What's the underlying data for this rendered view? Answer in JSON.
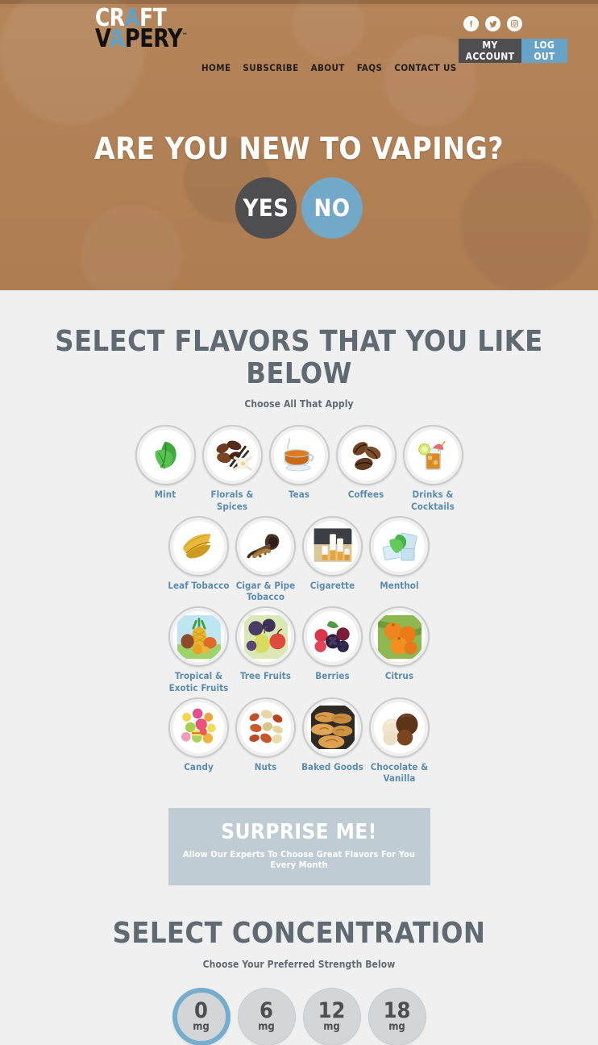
{
  "brand": {
    "logo_line1": "CRAFT",
    "logo_line2": "VAPERY",
    "trademark": "™",
    "accent_blue": "#64a0c4",
    "hero_bg": "#b28156",
    "page_bg": "#f0f0f0"
  },
  "header": {
    "social": [
      {
        "name": "facebook-icon",
        "label": "f"
      },
      {
        "name": "twitter-icon",
        "label": "t"
      },
      {
        "name": "instagram-icon",
        "label": "ig"
      }
    ],
    "my_account_label": "MY ACCOUNT",
    "log_out_label": "LOG OUT",
    "nav": [
      {
        "label": "HOME"
      },
      {
        "label": "SUBSCRIBE"
      },
      {
        "label": "ABOUT"
      },
      {
        "label": "FAQS"
      },
      {
        "label": "CONTACT US"
      }
    ]
  },
  "hero": {
    "question": "ARE YOU NEW TO VAPING?",
    "yes_label": "YES",
    "no_label": "NO"
  },
  "flavors_section": {
    "title": "SELECT FLAVORS THAT YOU LIKE BELOW",
    "subtitle": "Choose All That Apply",
    "rows": [
      [
        {
          "label": "Mint",
          "icon": "mint-leaves"
        },
        {
          "label": "Florals & Spices",
          "icon": "chocolate-vanilla-flower"
        },
        {
          "label": "Teas",
          "icon": "teacup"
        },
        {
          "label": "Coffees",
          "icon": "coffee-beans"
        },
        {
          "label": "Drinks & Cocktails",
          "icon": "cocktail-glass"
        }
      ],
      [
        {
          "label": "Leaf Tobacco",
          "icon": "tobacco-leaf"
        },
        {
          "label": "Cigar & Pipe Tobacco",
          "icon": "pipe"
        },
        {
          "label": "Cigarette",
          "icon": "cigarettes"
        },
        {
          "label": "Menthol",
          "icon": "mint-ice"
        }
      ],
      [
        {
          "label": "Tropical & Exotic Fruits",
          "icon": "pineapple-mango"
        },
        {
          "label": "Tree Fruits",
          "icon": "pear-apple-plum"
        },
        {
          "label": "Berries",
          "icon": "mixed-berries"
        },
        {
          "label": "Citrus",
          "icon": "oranges"
        }
      ],
      [
        {
          "label": "Candy",
          "icon": "candies"
        },
        {
          "label": "Nuts",
          "icon": "mixed-nuts"
        },
        {
          "label": "Baked Goods",
          "icon": "bread-loaves"
        },
        {
          "label": "Chocolate & Vanilla",
          "icon": "ice-cream-scoops"
        }
      ]
    ]
  },
  "surprise": {
    "title": "SURPRISE ME!",
    "subtitle": "Allow Our Experts To Choose Great Flavors For You Every Month",
    "bg": "#bfccd4"
  },
  "concentration_section": {
    "title": "SELECT CONCENTRATION",
    "subtitle": "Choose Your Preferred Strength Below",
    "unit": "mg",
    "options": [
      {
        "value": "0",
        "selected": true
      },
      {
        "value": "6",
        "selected": false
      },
      {
        "value": "12",
        "selected": false
      },
      {
        "value": "18",
        "selected": false
      }
    ],
    "selected_color": "#74adcd"
  }
}
